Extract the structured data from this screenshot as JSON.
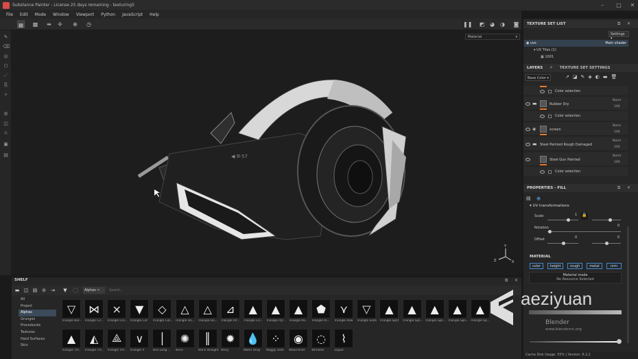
{
  "window": {
    "title": "Substance Painter - License 25 days remaining - texturing5"
  },
  "menu": [
    "File",
    "Edit",
    "Mode",
    "Window",
    "Viewport",
    "Python",
    "JavaScript",
    "Help"
  ],
  "viewport": {
    "material_select": "Material"
  },
  "texture_set_list": {
    "title": "TEXTURE SET LIST",
    "settings": "Settings",
    "set_name": "uvs",
    "shader": "Main shader",
    "uv_tiles": "UV Tiles (1)",
    "tile": "1001"
  },
  "layers_panel": {
    "tab_layers": "LAYERS",
    "tab_tss": "TEXTURE SET SETTINGS",
    "channel": "Base Color",
    "items": [
      {
        "name": "Color selection",
        "type": "mask"
      },
      {
        "name": "Rubber Dry",
        "blend": "Norm",
        "opacity": "100"
      },
      {
        "name": "Color selection",
        "type": "mask"
      },
      {
        "name": "screen",
        "blend": "Norm",
        "opacity": "100"
      },
      {
        "name": "Steel Painted Rough Damaged",
        "blend": "Norm",
        "opacity": "100"
      },
      {
        "name": "Steel Gun Painted",
        "blend": "Norm",
        "opacity": "100"
      },
      {
        "name": "Color selection",
        "type": "mask"
      }
    ]
  },
  "properties": {
    "title": "PROPERTIES - FILL",
    "uv_section": "UV transformations",
    "scale_label": "Scale",
    "scale_val": "1",
    "rotation_label": "Rotation",
    "rotation_val": "0",
    "offset_label": "Offset",
    "offset_x": "0",
    "offset_y": "0",
    "material_section": "MATERIAL",
    "channels": [
      "color",
      "height",
      "rough",
      "metal",
      "nrm"
    ],
    "material_mode": "Material mode",
    "no_resource": "No Resource Selected"
  },
  "shelf": {
    "title": "SHELF",
    "filter_tag": "Alphas",
    "search_placeholder": "Search...",
    "categories": [
      "All",
      "Project",
      "Alphas",
      "Grunges",
      "Procedurals",
      "Textures",
      "Hard Surfaces",
      "Skin"
    ],
    "selected_category": "Alphas",
    "row1": [
      "Triangle Bor...",
      "Triangle Cir...",
      "Triangle Cro...",
      "Triangle Cut",
      "Triangle Cut...",
      "Triangle Do...",
      "Triangle Do...",
      "Triangle Inf...",
      "Triangle Lin...",
      "Triangle Pyr...",
      "Triangle Ra...",
      "Triangle Ri...",
      "Triangle Row",
      "Triangle Slide",
      "Triangle Split",
      "Triangle Spli...",
      "Triangle Spli...",
      "Triangle Spli...",
      "Triangle Sq..."
    ],
    "row2": [
      "Triangle Thi...",
      "Triangle Thi...",
      "Triangle Trif...",
      "Triangle V",
      "Vein Long ...",
      "Veins",
      "Veins Straight",
      "Veiny",
      "Water Drop",
      "Wiggly Dots",
      "Wood Knot",
      "Wrinkles",
      "Zipper"
    ]
  },
  "status": {
    "cache": "Cache Disk Usage:",
    "cache_pct": "55%",
    "version": "Version: 6.2.2"
  },
  "watermark": {
    "text": "aeziyuan",
    "sub1": "Blender",
    "sub2": "www.blendercn.org"
  },
  "colors": {
    "accent_orange": "#e8782a",
    "selection_blue": "#4a8ac8",
    "panel": "#262626",
    "viewport": "#1d1d1d"
  }
}
